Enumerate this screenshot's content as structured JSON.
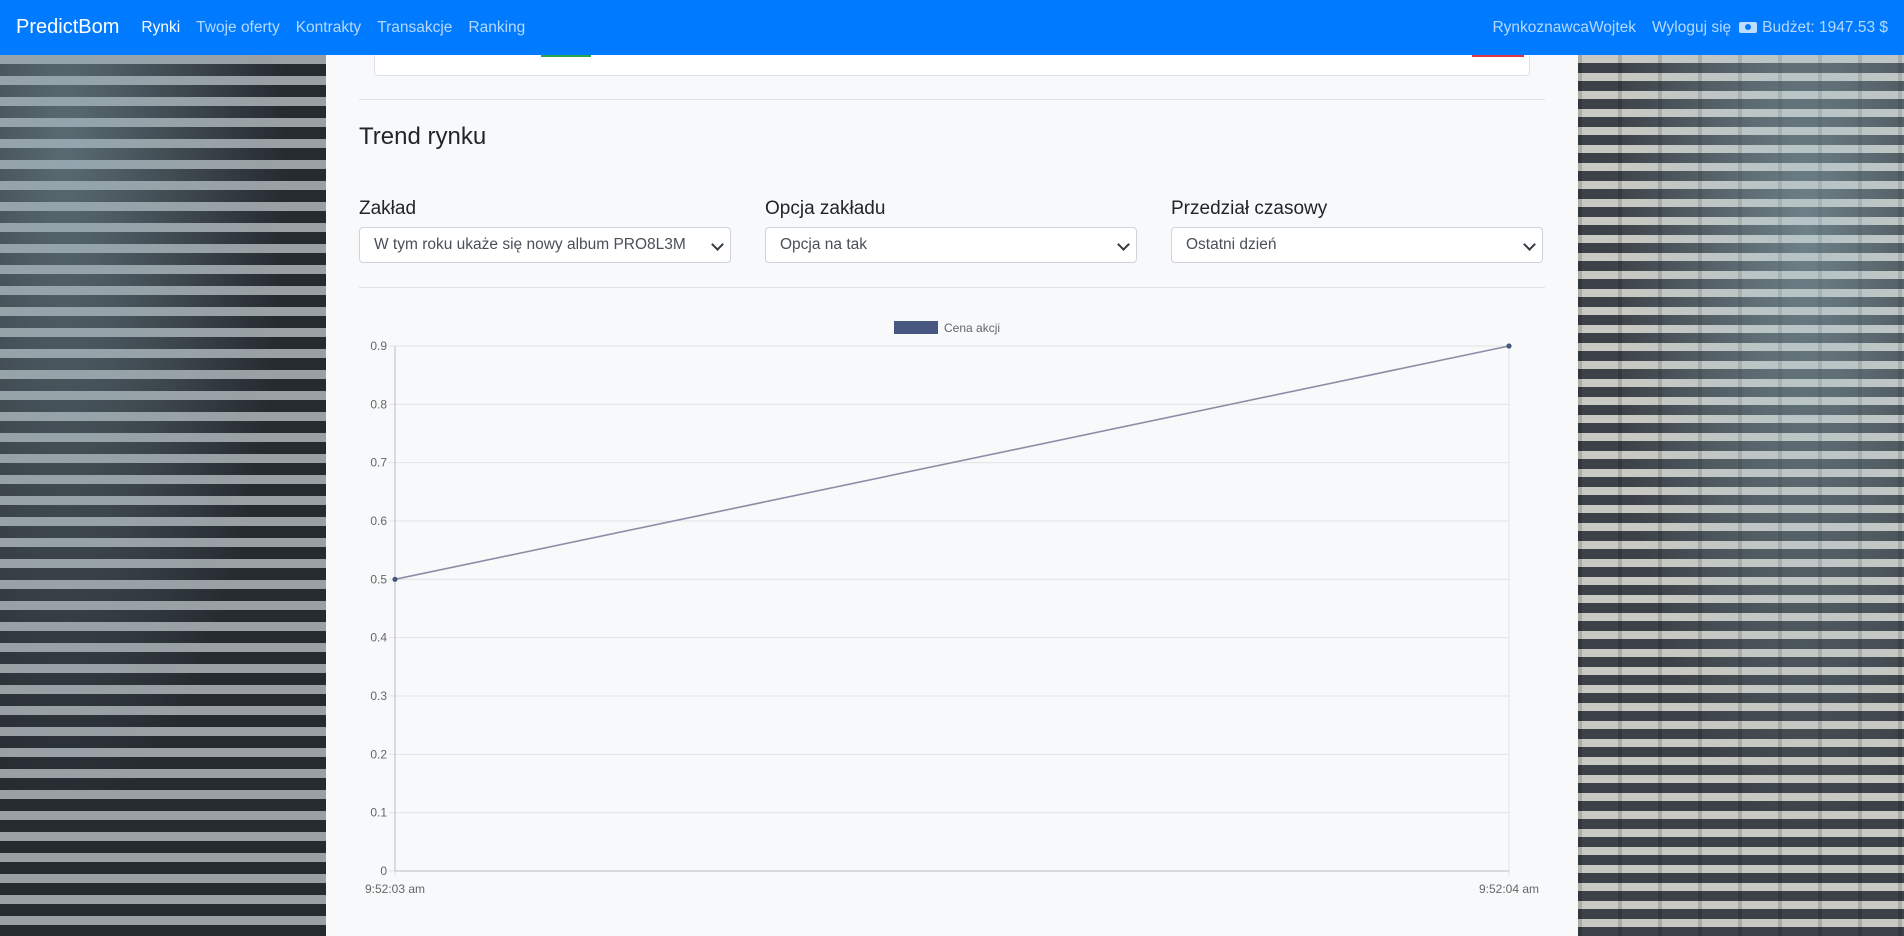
{
  "navbar": {
    "brand": "PredictBom",
    "links": [
      "Rynki",
      "Twoje oferty",
      "Kontrakty",
      "Transakcje",
      "Ranking"
    ],
    "username": "RynkoznawcaWojtek",
    "logout": "Wyloguj się",
    "budget": "Budżet: 1947.53 $",
    "color": "#007bff"
  },
  "trend": {
    "title": "Trend rynku",
    "bet_label": "Zakład",
    "bet_value": "W tym roku ukaże się nowy album PRO8L3M",
    "option_label": "Opcja zakładu",
    "option_value": "Opcja na tak",
    "range_label": "Przedział czasowy",
    "range_value": "Ostatni dzień"
  },
  "chart_data": {
    "type": "line",
    "x": [
      "9:52:03 am",
      "9:52:04 am"
    ],
    "series": [
      {
        "name": "Cena akcji",
        "values": [
          0.5,
          0.9
        ],
        "color": "#47577f"
      }
    ],
    "ylim": [
      0,
      0.9
    ],
    "yticks": [
      "0",
      "0.1",
      "0.2",
      "0.3",
      "0.4",
      "0.5",
      "0.6",
      "0.7",
      "0.8",
      "0.9"
    ],
    "grid": true,
    "legend": "top-center"
  }
}
